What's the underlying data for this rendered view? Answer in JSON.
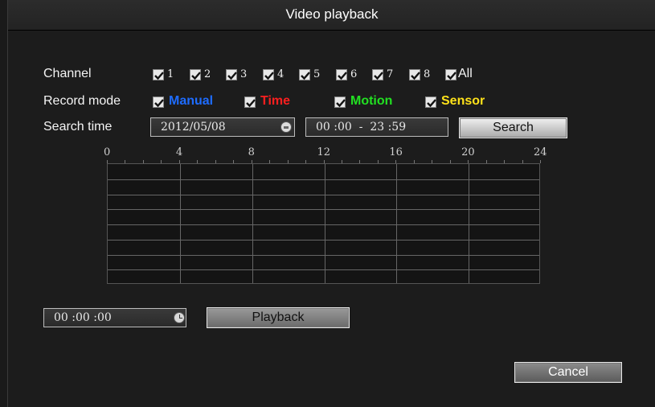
{
  "title": "Video playback",
  "channel": {
    "label": "Channel",
    "items": [
      "1",
      "2",
      "3",
      "4",
      "5",
      "6",
      "7",
      "8"
    ],
    "all_label": "All"
  },
  "record_mode": {
    "label": "Record mode",
    "manual": {
      "label": "Manual",
      "color": "#1e6cff"
    },
    "time": {
      "label": "Time",
      "color": "#ff1f1f"
    },
    "motion": {
      "label": "Motion",
      "color": "#22e022"
    },
    "sensor": {
      "label": "Sensor",
      "color": "#ffe21a"
    }
  },
  "search_time": {
    "label": "Search time",
    "date": "2012/05/08",
    "range": "00 :00  -  23 :59",
    "search_label": "Search"
  },
  "timeline": {
    "hours": [
      "0",
      "4",
      "8",
      "12",
      "16",
      "20",
      "24"
    ]
  },
  "playback": {
    "time": "00 :00 :00",
    "button_label": "Playback"
  },
  "cancel_label": "Cancel"
}
